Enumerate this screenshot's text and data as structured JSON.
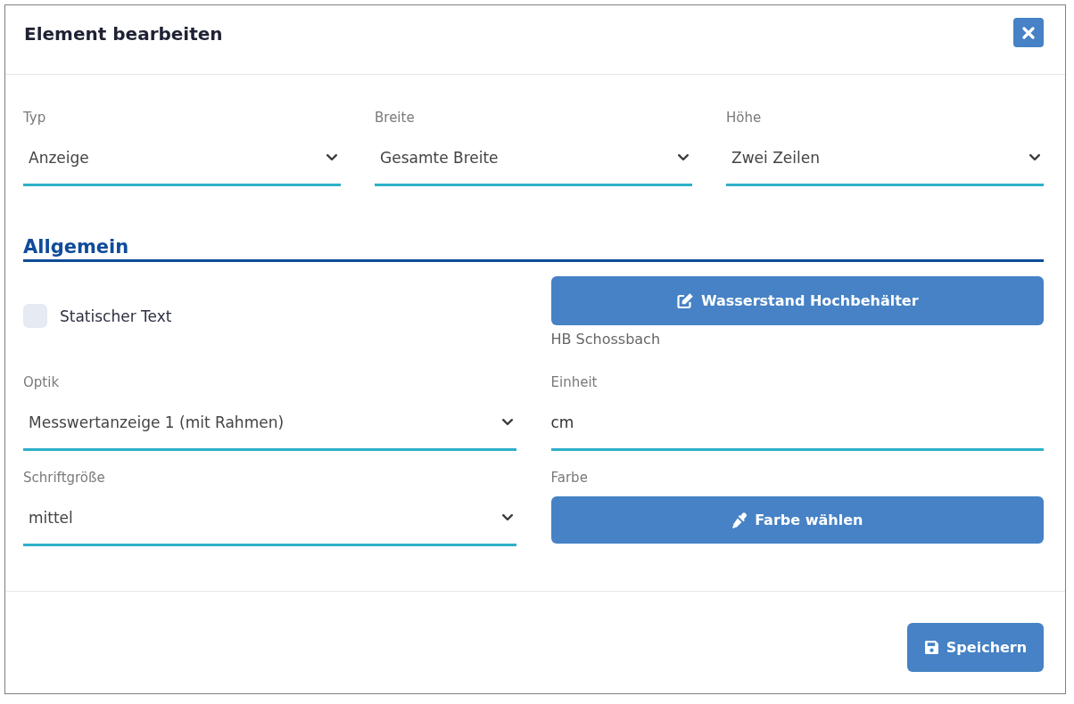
{
  "dialog": {
    "title": "Element bearbeiten"
  },
  "fields": [
    {
      "label": "Typ",
      "value": "Anzeige"
    },
    {
      "label": "Breite",
      "value": "Gesamte Breite"
    },
    {
      "label": "Höhe",
      "value": "Zwei Zeilen"
    }
  ],
  "general": {
    "title": "Allgemein",
    "items": [
      {
        "kind": "checkbox",
        "label": "Statischer Text",
        "checked": false
      },
      {
        "kind": "edit_button",
        "label": "Wasserstand Hochbehälter",
        "caption": "HB Schossbach"
      },
      {
        "kind": "select",
        "label": "Optik",
        "value": "Messwertanzeige 1 (mit Rahmen)"
      },
      {
        "kind": "input",
        "label": "Einheit",
        "value": "cm"
      },
      {
        "kind": "select",
        "label": "Schriftgröße",
        "value": "mittel"
      },
      {
        "kind": "color_button",
        "label": "Farbe",
        "button": "Farbe wählen"
      }
    ]
  },
  "footer": {
    "save_button": "Speichern"
  }
}
